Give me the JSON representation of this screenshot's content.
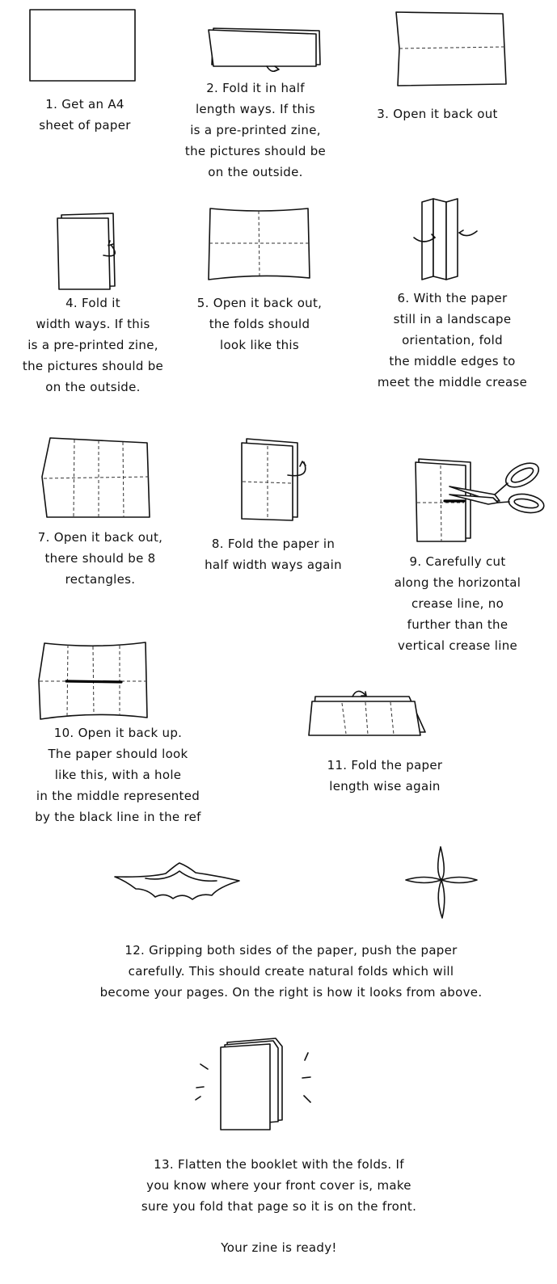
{
  "steps": [
    {
      "id": 1,
      "text": "1. Get an A4\nsheet of paper"
    },
    {
      "id": 2,
      "text": "2. Fold it in half\nlength ways. If this\nis a pre-printed zine,\nthe pictures should be\non the outside."
    },
    {
      "id": 3,
      "text": "3. Open it back out"
    },
    {
      "id": 4,
      "text": "4. Fold it\nwidth ways. If this\nis a pre-printed zine,\nthe pictures should be\non the outside."
    },
    {
      "id": 5,
      "text": "5. Open it back out,\nthe folds should\nlook like this"
    },
    {
      "id": 6,
      "text": "6. With the paper\nstill in a landscape\norientation, fold\nthe middle edges to\nmeet the middle crease"
    },
    {
      "id": 7,
      "text": "7. Open it back out,\nthere should be 8\nrectangles."
    },
    {
      "id": 8,
      "text": "8. Fold the paper in\nhalf width ways again"
    },
    {
      "id": 9,
      "text": "9. Carefully cut\nalong the horizontal\ncrease line, no\nfurther than the\nvertical crease line"
    },
    {
      "id": 10,
      "text": "10. Open it back up.\nThe paper should look\nlike this, with a hole\nin the middle represented\nby the black line in the ref"
    },
    {
      "id": 11,
      "text": "11. Fold the paper\nlength wise again"
    },
    {
      "id": 12,
      "text": "12. Gripping both sides of the paper, push the paper\ncarefully. This should create natural folds which will\nbecome your pages. On the right is how it looks from above."
    },
    {
      "id": 13,
      "text": "13. Flatten the booklet with the folds. If\nyou know where your front cover is, make\nsure you fold that page so it is on the front."
    }
  ],
  "closing": "Your zine is ready!"
}
